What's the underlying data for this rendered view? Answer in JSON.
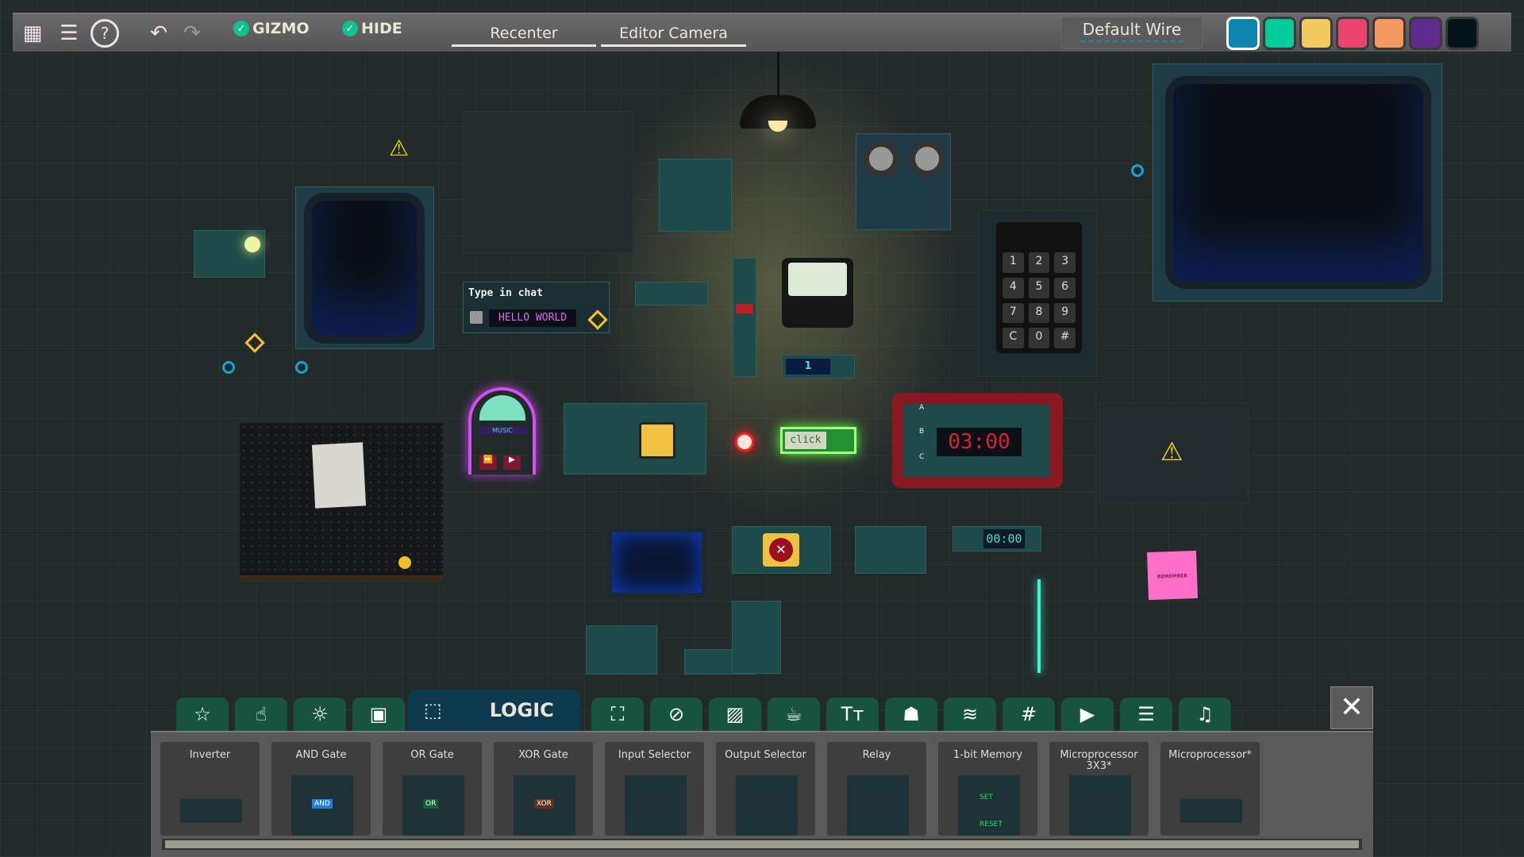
{
  "toolbar": {
    "icons": [
      "grid-icon",
      "list-icon",
      "help-icon",
      "undo-icon",
      "redo-icon"
    ],
    "gizmo_label": "GIZMO",
    "gizmo_checked": true,
    "hide_label": "HIDE",
    "hide_checked": true,
    "recenter_label": "Recenter",
    "editor_camera_label": "Editor Camera",
    "wire_label": "Default Wire",
    "wire_colors": [
      "#0b87ad",
      "#00cc99",
      "#f4c95d",
      "#e8446d",
      "#f59a5e",
      "#5e2a8e",
      "#031319"
    ],
    "selected_color": "#0b87ad"
  },
  "scene": {
    "chat_title": "Type in chat",
    "chat_text": "HELLO WORLD",
    "jukebox_label": "MUSIC",
    "click_button": "click",
    "counter_value": "1",
    "bomb_timer": "03:00",
    "bomb_inputs": [
      "A",
      "B",
      "C"
    ],
    "clock_display": "00:00",
    "keypad": [
      "1",
      "2",
      "3",
      "4",
      "5",
      "6",
      "7",
      "8",
      "9",
      "C",
      "0",
      "#"
    ],
    "sticky_note": "REMEMBER",
    "gate_labels": {
      "and": "AND",
      "or": "OR",
      "xor": "XOR",
      "set": "SET",
      "reset": "RESET"
    }
  },
  "category_tabs": [
    {
      "icon": "star-icon",
      "glyph": "☆"
    },
    {
      "icon": "hand-pointer-icon",
      "glyph": "☝"
    },
    {
      "icon": "light-icon",
      "glyph": "☼"
    },
    {
      "icon": "toolbox-icon",
      "glyph": "▣"
    },
    {
      "icon": "chip-icon",
      "glyph": "⬚",
      "label": "LOGIC",
      "active": true
    },
    {
      "icon": "fullscreen-icon",
      "glyph": "⛶"
    },
    {
      "icon": "eye-off-icon",
      "glyph": "⊘"
    },
    {
      "icon": "image-icon",
      "glyph": "▨"
    },
    {
      "icon": "cup-icon",
      "glyph": "☕"
    },
    {
      "icon": "text-icon",
      "glyph": "Tт"
    },
    {
      "icon": "robot-icon",
      "glyph": "☗"
    },
    {
      "icon": "router-icon",
      "glyph": "≋"
    },
    {
      "icon": "hash-icon",
      "glyph": "#"
    },
    {
      "icon": "play-icon",
      "glyph": "▶"
    },
    {
      "icon": "server-icon",
      "glyph": "☰"
    },
    {
      "icon": "music-icon",
      "glyph": "♫"
    }
  ],
  "close_label": "✕",
  "components": [
    "Inverter",
    "AND Gate",
    "OR Gate",
    "XOR Gate",
    "Input Selector",
    "Output Selector",
    "Relay",
    "1-bit Memory",
    "Microprocessor 3X3*",
    "Microprocessor*"
  ]
}
